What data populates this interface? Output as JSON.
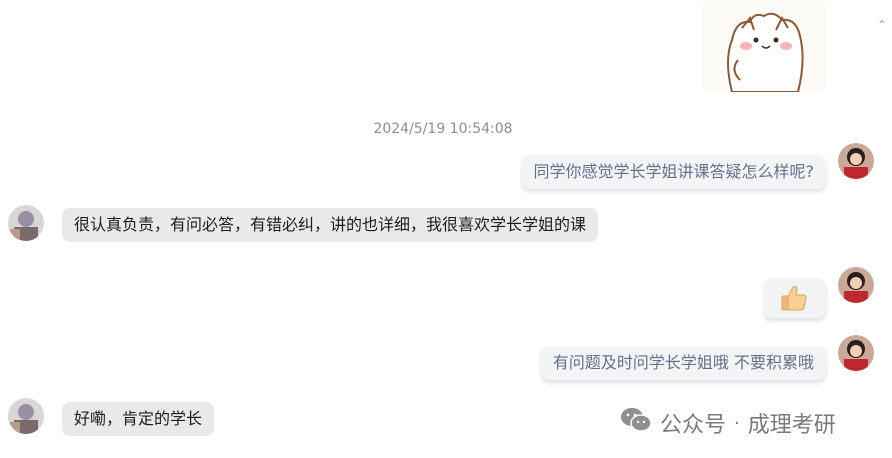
{
  "conversation": {
    "timestamp": "2024/5/19 10:54:08",
    "messages": [
      {
        "direction": "outgoing",
        "type": "text",
        "text": "同学你感觉学长学姐讲课答疑怎么样呢?"
      },
      {
        "direction": "incoming",
        "type": "text",
        "text": "很认真负责，有问必答，有错必纠，讲的也详细，我很喜欢学长学姐的课"
      },
      {
        "direction": "outgoing",
        "type": "emoji",
        "icon": "thumbs-up-icon"
      },
      {
        "direction": "outgoing",
        "type": "text",
        "text": "有问题及时问学长学姐哦 不要积累哦"
      },
      {
        "direction": "incoming",
        "type": "text",
        "text": "好嘞，肯定的学长"
      }
    ],
    "sticker": {
      "icon": "cat-sticker-icon"
    }
  },
  "watermark": {
    "brand": "公众号",
    "separator": "·",
    "account": "成理考研"
  },
  "colors": {
    "outgoing_bubble": "#f3f4f6",
    "outgoing_text": "#67708a",
    "incoming_bubble": "#e9e9eb",
    "incoming_text": "#1d1d1d",
    "timestamp_text": "#8d8d8d"
  }
}
